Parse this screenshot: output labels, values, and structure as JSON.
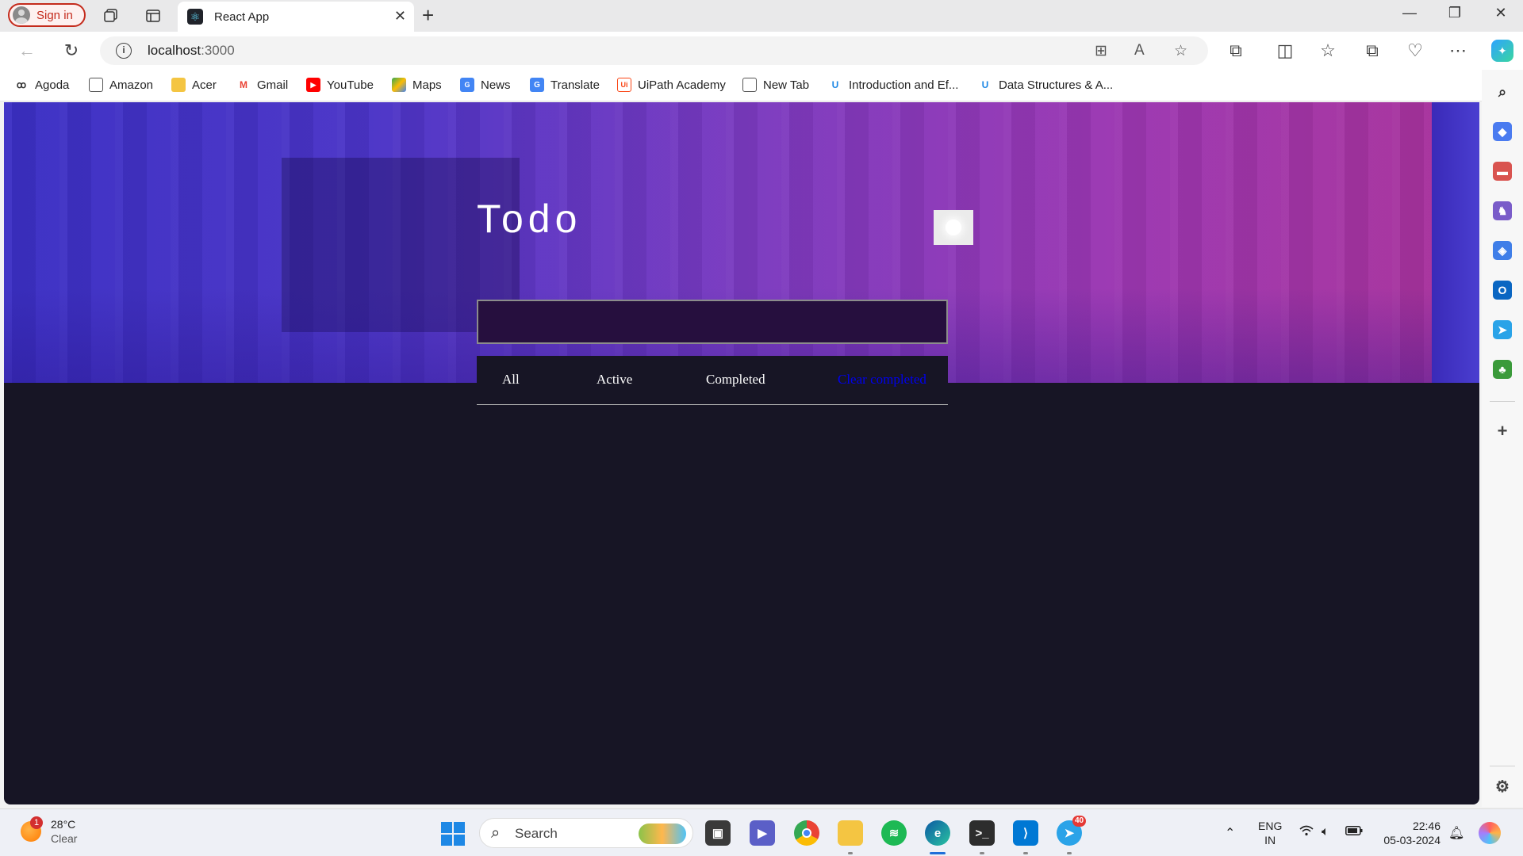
{
  "browser": {
    "signin_label": "Sign in",
    "tab_title": "React App",
    "url_host": "localhost",
    "url_port": ":3000"
  },
  "favorites": [
    {
      "label": "Agoda",
      "icon": "agoda-icon",
      "color": "#333333"
    },
    {
      "label": "Amazon",
      "icon": "page-icon",
      "color": "#555555"
    },
    {
      "label": "Acer",
      "icon": "folder-icon",
      "color": "#f4c542"
    },
    {
      "label": "Gmail",
      "icon": "gmail-icon",
      "color": "#ea4335"
    },
    {
      "label": "YouTube",
      "icon": "youtube-icon",
      "color": "#ff0000"
    },
    {
      "label": "Maps",
      "icon": "maps-icon",
      "color": "#34a853"
    },
    {
      "label": "News",
      "icon": "news-icon",
      "color": "#4285f4"
    },
    {
      "label": "Translate",
      "icon": "translate-icon",
      "color": "#4285f4"
    },
    {
      "label": "UiPath Academy",
      "icon": "uipath-icon",
      "color": "#fa4616"
    },
    {
      "label": "New Tab",
      "icon": "page-icon",
      "color": "#555555"
    },
    {
      "label": "Introduction and Ef...",
      "icon": "udemy-icon",
      "color": "#1e88e5"
    },
    {
      "label": "Data Structures & A...",
      "icon": "udemy-icon",
      "color": "#1e88e5"
    }
  ],
  "app": {
    "title": "Todo",
    "input_value": "",
    "filters": {
      "all": "All",
      "active": "Active",
      "completed": "Completed",
      "clear": "Clear completed"
    },
    "colors": {
      "background": "#171525",
      "input_bg": "#260f3e",
      "clear_link": "#0000ee"
    }
  },
  "taskbar": {
    "weather_temp": "28°C",
    "weather_cond": "Clear",
    "weather_badge": "1",
    "search_label": "Search",
    "telegram_badge": "40",
    "lang_top": "ENG",
    "lang_bottom": "IN",
    "time": "22:46",
    "date": "05-03-2024"
  }
}
